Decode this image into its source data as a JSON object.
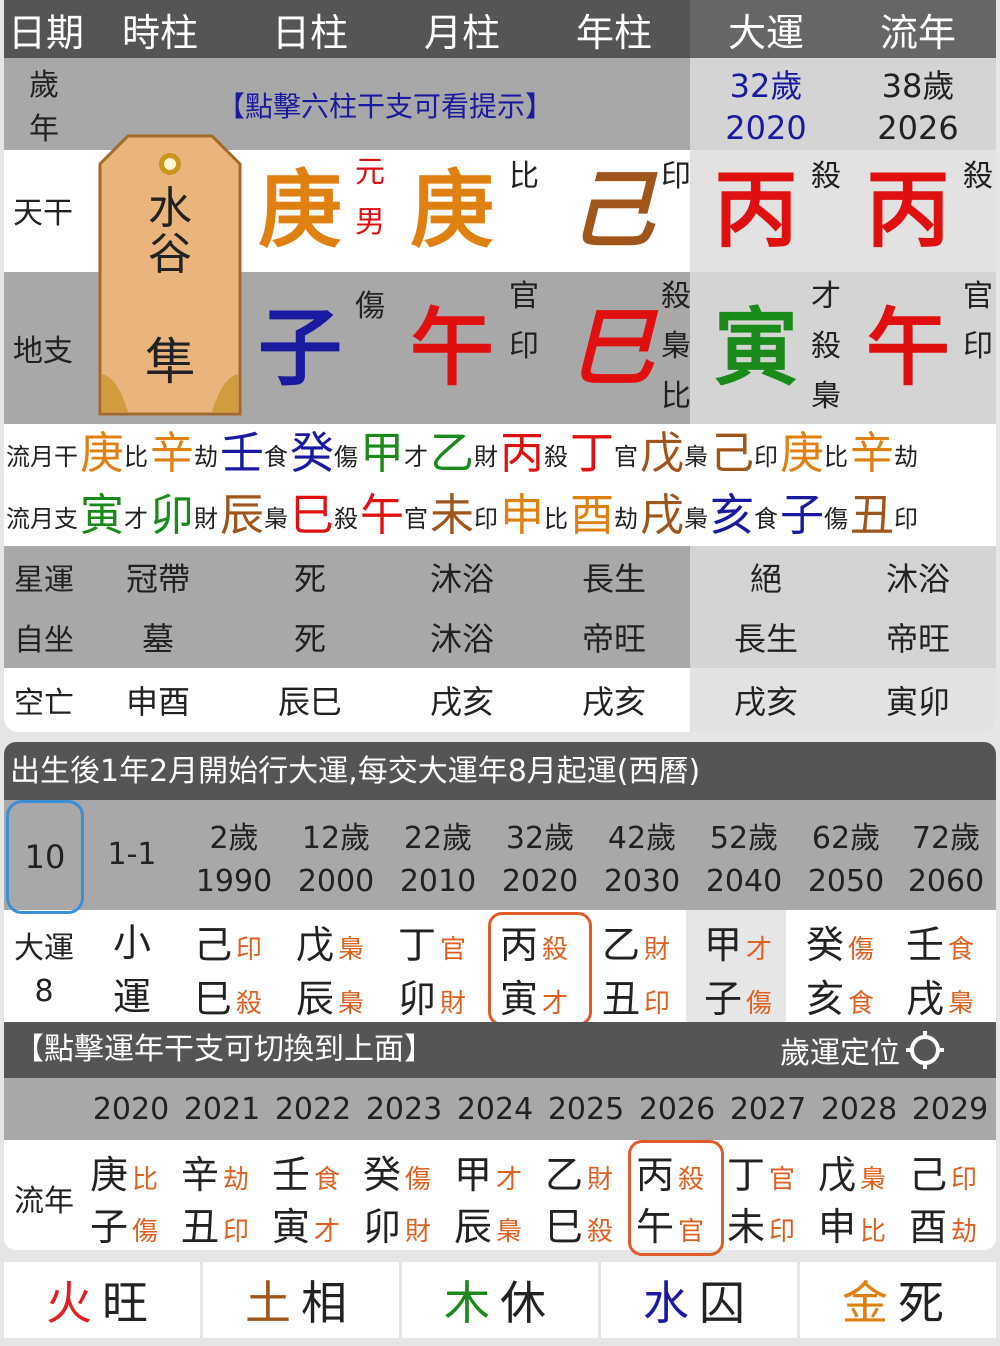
{
  "header": {
    "cols": [
      "日期",
      "時柱",
      "日柱",
      "月柱",
      "年柱",
      "大運",
      "流年"
    ]
  },
  "age_row": {
    "label_top": "歲",
    "label_bottom": "年",
    "hint": "【點擊六柱干支可看提示】",
    "dayun_age": "32歲",
    "dayun_year": "2020",
    "liunian_age": "38歲",
    "liunian_year": "2026"
  },
  "tiangan": {
    "label": "天干",
    "day": "庚",
    "day_tag_1": "元",
    "day_tag_2": "男",
    "month": "庚",
    "month_god": "比",
    "year": "己",
    "year_god": "印",
    "dayun": "丙",
    "dayun_god": "殺",
    "liunian": "丙",
    "liunian_god": "殺"
  },
  "dizhi": {
    "label": "地支",
    "day": "子",
    "day_gods": [
      "傷"
    ],
    "month": "午",
    "month_gods": [
      "官",
      "印"
    ],
    "year": "巳",
    "year_gods": [
      "殺",
      "梟",
      "比"
    ],
    "dayun": "寅",
    "dayun_gods": [
      "才",
      "殺",
      "梟"
    ],
    "liunian": "午",
    "liunian_gods": [
      "官",
      "印"
    ]
  },
  "tag": {
    "line1": "水谷",
    "line2": "隼"
  },
  "liuyue_gan": {
    "label": "流月干",
    "items": [
      {
        "c": "庚",
        "g": "比",
        "color": "#e08010"
      },
      {
        "c": "辛",
        "g": "劫",
        "color": "#e08010"
      },
      {
        "c": "壬",
        "g": "食",
        "color": "#1a1aa0"
      },
      {
        "c": "癸",
        "g": "傷",
        "color": "#1a1aa0"
      },
      {
        "c": "甲",
        "g": "才",
        "color": "#1a8a1a"
      },
      {
        "c": "乙",
        "g": "財",
        "color": "#1a8a1a"
      },
      {
        "c": "丙",
        "g": "殺",
        "color": "#e01010"
      },
      {
        "c": "丁",
        "g": "官",
        "color": "#e01010"
      },
      {
        "c": "戊",
        "g": "梟",
        "color": "#a0561a"
      },
      {
        "c": "己",
        "g": "印",
        "color": "#a0561a"
      },
      {
        "c": "庚",
        "g": "比",
        "color": "#e08010"
      },
      {
        "c": "辛",
        "g": "劫",
        "color": "#e08010"
      }
    ]
  },
  "liuyue_zhi": {
    "label": "流月支",
    "items": [
      {
        "c": "寅",
        "g": "才",
        "color": "#1a8a1a"
      },
      {
        "c": "卯",
        "g": "財",
        "color": "#1a8a1a"
      },
      {
        "c": "辰",
        "g": "梟",
        "color": "#a0561a"
      },
      {
        "c": "巳",
        "g": "殺",
        "color": "#e01010"
      },
      {
        "c": "午",
        "g": "官",
        "color": "#e01010"
      },
      {
        "c": "未",
        "g": "印",
        "color": "#a0561a"
      },
      {
        "c": "申",
        "g": "比",
        "color": "#e08010"
      },
      {
        "c": "酉",
        "g": "劫",
        "color": "#e08010"
      },
      {
        "c": "戌",
        "g": "梟",
        "color": "#a0561a"
      },
      {
        "c": "亥",
        "g": "食",
        "color": "#1a1aa0"
      },
      {
        "c": "子",
        "g": "傷",
        "color": "#1a1aa0"
      },
      {
        "c": "丑",
        "g": "印",
        "color": "#a0561a"
      }
    ]
  },
  "xingyun": {
    "label": "星運",
    "values": [
      "冠帶",
      "死",
      "沐浴",
      "長生",
      "絕",
      "沐浴"
    ]
  },
  "zizuo": {
    "label": "自坐",
    "values": [
      "墓",
      "死",
      "沐浴",
      "帝旺",
      "長生",
      "帝旺"
    ]
  },
  "kongwang": {
    "label": "空亡",
    "values": [
      "申酉",
      "辰巳",
      "戌亥",
      "戌亥",
      "戌亥",
      "寅卯"
    ]
  },
  "dayun_banner": "出生後1年2月開始行大運,每交大運年8月起運(西曆)",
  "dayun_list": {
    "selected": "10",
    "first_age": "1-1",
    "ages": [
      "2歲",
      "12歲",
      "22歲",
      "32歲",
      "42歲",
      "52歲",
      "62歲",
      "72歲"
    ],
    "years": [
      "1990",
      "2000",
      "2010",
      "2020",
      "2030",
      "2040",
      "2050",
      "2060"
    ],
    "label": "大運",
    "label_num": "8",
    "xiao1": "小",
    "xiao2": "運",
    "pillars": [
      {
        "g": "己",
        "gs": "印",
        "z": "巳",
        "zs": "殺"
      },
      {
        "g": "戊",
        "gs": "梟",
        "z": "辰",
        "zs": "梟"
      },
      {
        "g": "丁",
        "gs": "官",
        "z": "卯",
        "zs": "財"
      },
      {
        "g": "丙",
        "gs": "殺",
        "z": "寅",
        "zs": "才"
      },
      {
        "g": "乙",
        "gs": "財",
        "z": "丑",
        "zs": "印"
      },
      {
        "g": "甲",
        "gs": "才",
        "z": "子",
        "zs": "傷"
      },
      {
        "g": "癸",
        "gs": "傷",
        "z": "亥",
        "zs": "食"
      },
      {
        "g": "壬",
        "gs": "食",
        "z": "戌",
        "zs": "梟"
      }
    ]
  },
  "liunian_banner": {
    "hint": "【點擊運年干支可切換到上面】",
    "locate": "歲運定位"
  },
  "liunian_list": {
    "label": "流年",
    "years": [
      "2020",
      "2021",
      "2022",
      "2023",
      "2024",
      "2025",
      "2026",
      "2027",
      "2028",
      "2029"
    ],
    "pillars": [
      {
        "g": "庚",
        "gs": "比",
        "z": "子",
        "zs": "傷"
      },
      {
        "g": "辛",
        "gs": "劫",
        "z": "丑",
        "zs": "印"
      },
      {
        "g": "壬",
        "gs": "食",
        "z": "寅",
        "zs": "才"
      },
      {
        "g": "癸",
        "gs": "傷",
        "z": "卯",
        "zs": "財"
      },
      {
        "g": "甲",
        "gs": "才",
        "z": "辰",
        "zs": "梟"
      },
      {
        "g": "乙",
        "gs": "財",
        "z": "巳",
        "zs": "殺"
      },
      {
        "g": "丙",
        "gs": "殺",
        "z": "午",
        "zs": "官"
      },
      {
        "g": "丁",
        "gs": "官",
        "z": "未",
        "zs": "印"
      },
      {
        "g": "戊",
        "gs": "梟",
        "z": "申",
        "zs": "比"
      },
      {
        "g": "己",
        "gs": "印",
        "z": "酉",
        "zs": "劫"
      }
    ]
  },
  "wuxing": [
    {
      "e": "火",
      "s": "旺",
      "color": "#e02020"
    },
    {
      "e": "土",
      "s": "相",
      "color": "#a0561a"
    },
    {
      "e": "木",
      "s": "休",
      "color": "#1a8a1a"
    },
    {
      "e": "水",
      "s": "囚",
      "color": "#1a1aa0"
    },
    {
      "e": "金",
      "s": "死",
      "color": "#e08010"
    }
  ],
  "colors": {
    "header_bg": "#555555",
    "gray_bg": "#a8a8a8",
    "light_bg": "#e2e2e2",
    "red": "#e01010",
    "blue": "#1a1aa0",
    "green": "#1a8a1a",
    "orange": "#e08010",
    "brown": "#a0561a",
    "hl": "#e05a2a",
    "sel": "#3a8fd8"
  }
}
